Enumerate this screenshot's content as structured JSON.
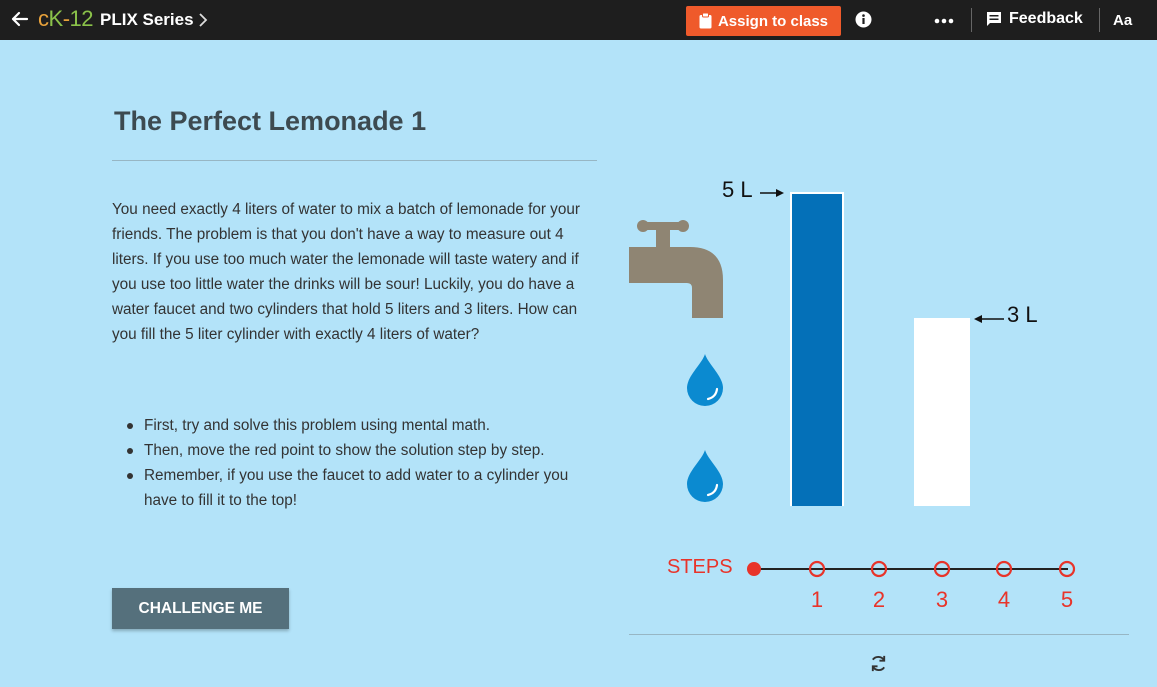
{
  "header": {
    "logo": {
      "c": "c",
      "k": "K",
      "dash": "-",
      "num": "12"
    },
    "series_label": "PLIX Series",
    "assign_label": "Assign to class",
    "feedback_label": "Feedback",
    "font_label": "Aa"
  },
  "content": {
    "title": "The Perfect Lemonade 1",
    "paragraph": "You need exactly 4 liters of water to mix a batch of lemonade for your friends. The problem is that you don't have a way to measure out 4 liters. If you use too much water the lemonade will taste watery and if you use too little water the drinks will be sour! Luckily, you do have a water faucet and two cylinders that hold 5 liters and 3 liters. How can you fill the 5 liter cylinder with exactly 4 liters of water?",
    "bullets": [
      "First, try and solve this problem using mental math.",
      "Then, move the red point to show the solution step by step.",
      "Remember, if you use the faucet to add water to a cylinder you have to fill it to the top!"
    ],
    "challenge_label": "CHALLENGE ME"
  },
  "interactive": {
    "cylinder_large_label": "5 L",
    "cylinder_small_label": "3 L",
    "cylinder_large_capacity_l": 5,
    "cylinder_large_water_l": 5,
    "cylinder_small_capacity_l": 3,
    "cylinder_small_water_l": 0,
    "steps_label": "STEPS",
    "steps": [
      "1",
      "2",
      "3",
      "4",
      "5"
    ],
    "current_step": 0,
    "colors": {
      "water": "#0470b8",
      "faucet": "#8f8573",
      "drop": "#0b8ad0",
      "step": "#e8342a",
      "accent": "#ef5a2b"
    }
  }
}
